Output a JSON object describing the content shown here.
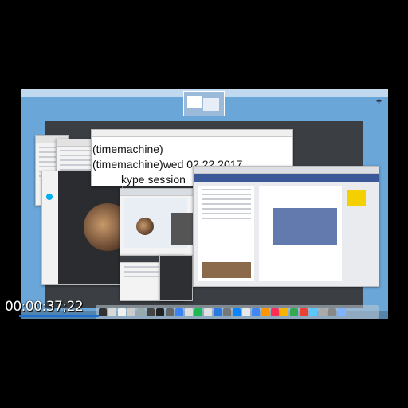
{
  "video": {
    "timecode": "00:00:37;22",
    "progress_fraction": 0.04
  },
  "overlay_text": {
    "line1": "(timemachine)",
    "line2": "(timemachine)wed 02 22 2017",
    "line3": "kype session"
  },
  "desktop": {
    "accent": "#6aa6d8",
    "dock_colors": [
      "#333333",
      "#d8d8d8",
      "#f0f0f0",
      "#cccccc",
      "#9aa",
      "#444444",
      "#222222",
      "#666666",
      "#3b82f6",
      "#dddddd",
      "#1db954",
      "#e0e0e0",
      "#2a7ae2",
      "#777777",
      "#0a84ff",
      "#e8e8e8",
      "#4285f4",
      "#ff9500",
      "#ff2d55",
      "#f4b400",
      "#34a853",
      "#ea4335",
      "#5ac8fa",
      "#aaaaaa",
      "#888888",
      "#7fb3ff"
    ]
  },
  "facebook": {
    "brand_color": "#3b5998"
  }
}
